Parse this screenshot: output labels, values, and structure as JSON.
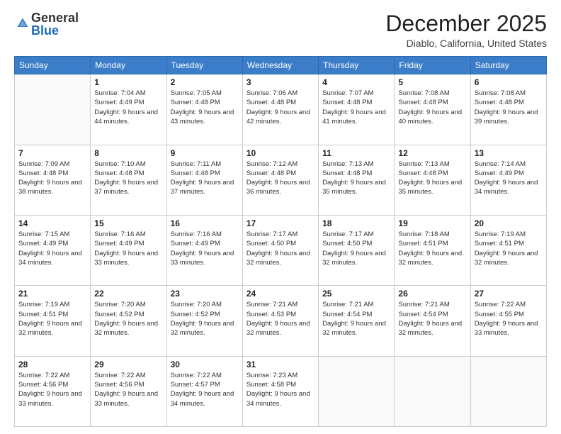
{
  "header": {
    "logo": {
      "general": "General",
      "blue": "Blue"
    },
    "title": "December 2025",
    "location": "Diablo, California, United States"
  },
  "weekdays": [
    "Sunday",
    "Monday",
    "Tuesday",
    "Wednesday",
    "Thursday",
    "Friday",
    "Saturday"
  ],
  "weeks": [
    [
      {
        "day": "",
        "sunrise": "",
        "sunset": "",
        "daylight": ""
      },
      {
        "day": "1",
        "sunrise": "Sunrise: 7:04 AM",
        "sunset": "Sunset: 4:49 PM",
        "daylight": "Daylight: 9 hours and 44 minutes."
      },
      {
        "day": "2",
        "sunrise": "Sunrise: 7:05 AM",
        "sunset": "Sunset: 4:48 PM",
        "daylight": "Daylight: 9 hours and 43 minutes."
      },
      {
        "day": "3",
        "sunrise": "Sunrise: 7:06 AM",
        "sunset": "Sunset: 4:48 PM",
        "daylight": "Daylight: 9 hours and 42 minutes."
      },
      {
        "day": "4",
        "sunrise": "Sunrise: 7:07 AM",
        "sunset": "Sunset: 4:48 PM",
        "daylight": "Daylight: 9 hours and 41 minutes."
      },
      {
        "day": "5",
        "sunrise": "Sunrise: 7:08 AM",
        "sunset": "Sunset: 4:48 PM",
        "daylight": "Daylight: 9 hours and 40 minutes."
      },
      {
        "day": "6",
        "sunrise": "Sunrise: 7:08 AM",
        "sunset": "Sunset: 4:48 PM",
        "daylight": "Daylight: 9 hours and 39 minutes."
      }
    ],
    [
      {
        "day": "7",
        "sunrise": "Sunrise: 7:09 AM",
        "sunset": "Sunset: 4:48 PM",
        "daylight": "Daylight: 9 hours and 38 minutes."
      },
      {
        "day": "8",
        "sunrise": "Sunrise: 7:10 AM",
        "sunset": "Sunset: 4:48 PM",
        "daylight": "Daylight: 9 hours and 37 minutes."
      },
      {
        "day": "9",
        "sunrise": "Sunrise: 7:11 AM",
        "sunset": "Sunset: 4:48 PM",
        "daylight": "Daylight: 9 hours and 37 minutes."
      },
      {
        "day": "10",
        "sunrise": "Sunrise: 7:12 AM",
        "sunset": "Sunset: 4:48 PM",
        "daylight": "Daylight: 9 hours and 36 minutes."
      },
      {
        "day": "11",
        "sunrise": "Sunrise: 7:13 AM",
        "sunset": "Sunset: 4:48 PM",
        "daylight": "Daylight: 9 hours and 35 minutes."
      },
      {
        "day": "12",
        "sunrise": "Sunrise: 7:13 AM",
        "sunset": "Sunset: 4:48 PM",
        "daylight": "Daylight: 9 hours and 35 minutes."
      },
      {
        "day": "13",
        "sunrise": "Sunrise: 7:14 AM",
        "sunset": "Sunset: 4:49 PM",
        "daylight": "Daylight: 9 hours and 34 minutes."
      }
    ],
    [
      {
        "day": "14",
        "sunrise": "Sunrise: 7:15 AM",
        "sunset": "Sunset: 4:49 PM",
        "daylight": "Daylight: 9 hours and 34 minutes."
      },
      {
        "day": "15",
        "sunrise": "Sunrise: 7:16 AM",
        "sunset": "Sunset: 4:49 PM",
        "daylight": "Daylight: 9 hours and 33 minutes."
      },
      {
        "day": "16",
        "sunrise": "Sunrise: 7:16 AM",
        "sunset": "Sunset: 4:49 PM",
        "daylight": "Daylight: 9 hours and 33 minutes."
      },
      {
        "day": "17",
        "sunrise": "Sunrise: 7:17 AM",
        "sunset": "Sunset: 4:50 PM",
        "daylight": "Daylight: 9 hours and 32 minutes."
      },
      {
        "day": "18",
        "sunrise": "Sunrise: 7:17 AM",
        "sunset": "Sunset: 4:50 PM",
        "daylight": "Daylight: 9 hours and 32 minutes."
      },
      {
        "day": "19",
        "sunrise": "Sunrise: 7:18 AM",
        "sunset": "Sunset: 4:51 PM",
        "daylight": "Daylight: 9 hours and 32 minutes."
      },
      {
        "day": "20",
        "sunrise": "Sunrise: 7:19 AM",
        "sunset": "Sunset: 4:51 PM",
        "daylight": "Daylight: 9 hours and 32 minutes."
      }
    ],
    [
      {
        "day": "21",
        "sunrise": "Sunrise: 7:19 AM",
        "sunset": "Sunset: 4:51 PM",
        "daylight": "Daylight: 9 hours and 32 minutes."
      },
      {
        "day": "22",
        "sunrise": "Sunrise: 7:20 AM",
        "sunset": "Sunset: 4:52 PM",
        "daylight": "Daylight: 9 hours and 32 minutes."
      },
      {
        "day": "23",
        "sunrise": "Sunrise: 7:20 AM",
        "sunset": "Sunset: 4:52 PM",
        "daylight": "Daylight: 9 hours and 32 minutes."
      },
      {
        "day": "24",
        "sunrise": "Sunrise: 7:21 AM",
        "sunset": "Sunset: 4:53 PM",
        "daylight": "Daylight: 9 hours and 32 minutes."
      },
      {
        "day": "25",
        "sunrise": "Sunrise: 7:21 AM",
        "sunset": "Sunset: 4:54 PM",
        "daylight": "Daylight: 9 hours and 32 minutes."
      },
      {
        "day": "26",
        "sunrise": "Sunrise: 7:21 AM",
        "sunset": "Sunset: 4:54 PM",
        "daylight": "Daylight: 9 hours and 32 minutes."
      },
      {
        "day": "27",
        "sunrise": "Sunrise: 7:22 AM",
        "sunset": "Sunset: 4:55 PM",
        "daylight": "Daylight: 9 hours and 33 minutes."
      }
    ],
    [
      {
        "day": "28",
        "sunrise": "Sunrise: 7:22 AM",
        "sunset": "Sunset: 4:56 PM",
        "daylight": "Daylight: 9 hours and 33 minutes."
      },
      {
        "day": "29",
        "sunrise": "Sunrise: 7:22 AM",
        "sunset": "Sunset: 4:56 PM",
        "daylight": "Daylight: 9 hours and 33 minutes."
      },
      {
        "day": "30",
        "sunrise": "Sunrise: 7:22 AM",
        "sunset": "Sunset: 4:57 PM",
        "daylight": "Daylight: 9 hours and 34 minutes."
      },
      {
        "day": "31",
        "sunrise": "Sunrise: 7:23 AM",
        "sunset": "Sunset: 4:58 PM",
        "daylight": "Daylight: 9 hours and 34 minutes."
      },
      {
        "day": "",
        "sunrise": "",
        "sunset": "",
        "daylight": ""
      },
      {
        "day": "",
        "sunrise": "",
        "sunset": "",
        "daylight": ""
      },
      {
        "day": "",
        "sunrise": "",
        "sunset": "",
        "daylight": ""
      }
    ]
  ]
}
